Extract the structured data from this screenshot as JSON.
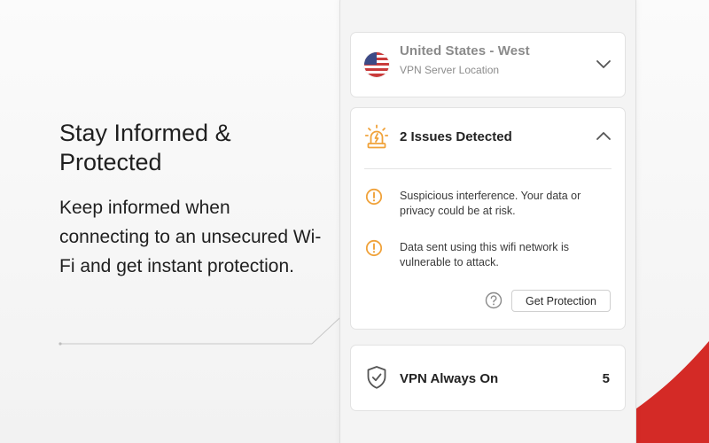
{
  "marketing": {
    "headline": "Stay Informed & Protected",
    "subcopy": "Keep informed when connecting to an unsecured Wi-Fi and get instant protection."
  },
  "location": {
    "title": "United States - West",
    "subtitle": "VPN Server Location",
    "flag_icon": "us-flag-icon",
    "expand_icon": "chevron-down-icon"
  },
  "issues": {
    "title": "2 Issues Detected",
    "icon": "alarm-light-icon",
    "collapse_icon": "chevron-up-icon",
    "items": [
      {
        "text": "Suspicious interference. Your data or privacy could be at risk.",
        "icon": "warning-circle-icon"
      },
      {
        "text": "Data sent using this wifi network is vulnerable to attack.",
        "icon": "warning-circle-icon"
      }
    ],
    "help_icon": "question-circle-icon",
    "action_label": "Get Protection"
  },
  "vpn": {
    "title": "VPN Always On",
    "icon": "shield-check-icon",
    "count": "5"
  },
  "colors": {
    "accent_red": "#d42a26",
    "warning_orange": "#f0a23a"
  }
}
